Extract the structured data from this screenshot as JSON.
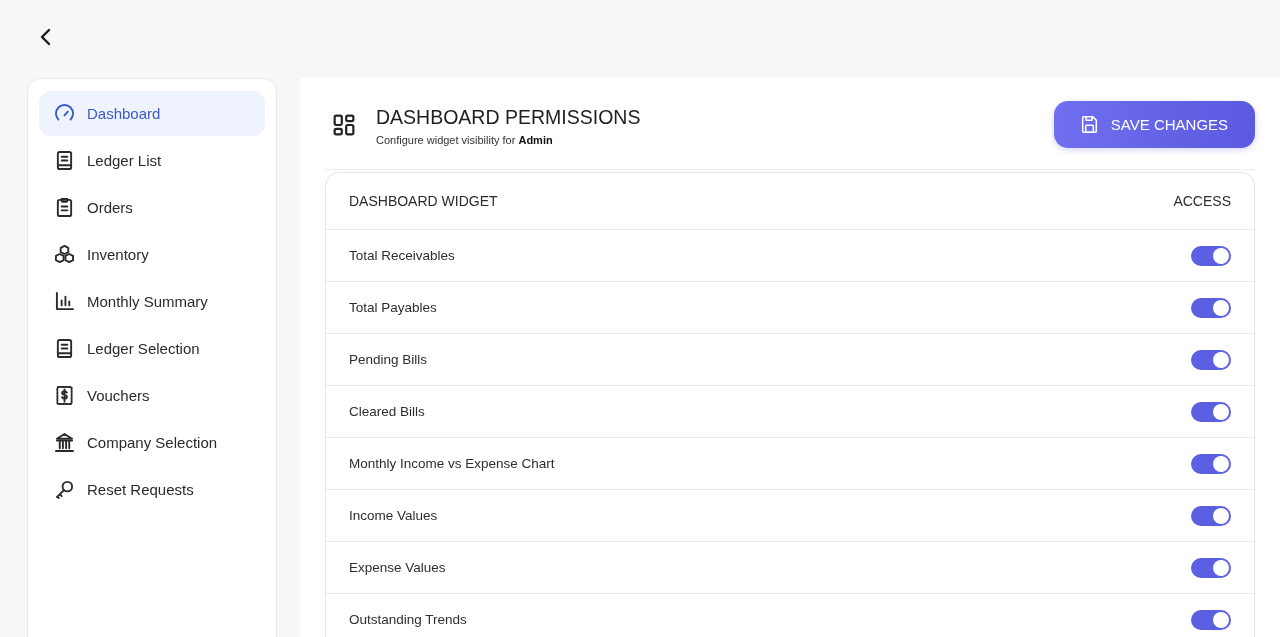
{
  "sidebar": {
    "items": [
      {
        "label": "Dashboard",
        "selected": true
      },
      {
        "label": "Ledger List",
        "selected": false
      },
      {
        "label": "Orders",
        "selected": false
      },
      {
        "label": "Inventory",
        "selected": false
      },
      {
        "label": "Monthly Summary",
        "selected": false
      },
      {
        "label": "Ledger Selection",
        "selected": false
      },
      {
        "label": "Vouchers",
        "selected": false
      },
      {
        "label": "Company Selection",
        "selected": false
      },
      {
        "label": "Reset Requests",
        "selected": false
      }
    ]
  },
  "header": {
    "title": "DASHBOARD PERMISSIONS",
    "subtitle": "Configure widget visibility for **Admin**"
  },
  "save_button": {
    "label": "SAVE CHANGES"
  },
  "table": {
    "columns": [
      "DASHBOARD WIDGET",
      "ACCESS"
    ],
    "rows": [
      {
        "widget": "Total Receivables",
        "on": true
      },
      {
        "widget": "Total Payables",
        "on": true
      },
      {
        "widget": "Pending Bills",
        "on": true
      },
      {
        "widget": "Cleared Bills",
        "on": true
      },
      {
        "widget": "Monthly Income vs Expense Chart",
        "on": true
      },
      {
        "widget": "Income Values",
        "on": true
      },
      {
        "widget": "Expense Values",
        "on": true
      },
      {
        "widget": "Outstanding Trends",
        "on": true
      }
    ]
  }
}
